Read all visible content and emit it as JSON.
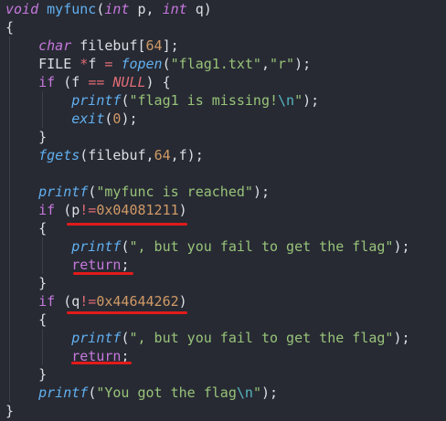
{
  "code": {
    "lines": [
      [
        {
          "t": "void",
          "c": "type"
        },
        {
          "t": " ",
          "c": "plain"
        },
        {
          "t": "myfunc",
          "c": "fn-plain"
        },
        {
          "t": "(",
          "c": "punc"
        },
        {
          "t": "int",
          "c": "type"
        },
        {
          "t": " p, ",
          "c": "plain"
        },
        {
          "t": "int",
          "c": "type"
        },
        {
          "t": " q)",
          "c": "plain"
        }
      ],
      [
        {
          "t": "{",
          "c": "plain"
        }
      ],
      [
        {
          "t": "    ",
          "c": "plain"
        },
        {
          "t": "char",
          "c": "type"
        },
        {
          "t": " filebuf[",
          "c": "plain"
        },
        {
          "t": "64",
          "c": "num"
        },
        {
          "t": "];",
          "c": "plain"
        }
      ],
      [
        {
          "t": "    FILE ",
          "c": "plain"
        },
        {
          "t": "*",
          "c": "op"
        },
        {
          "t": "f ",
          "c": "plain"
        },
        {
          "t": "=",
          "c": "op"
        },
        {
          "t": " ",
          "c": "plain"
        },
        {
          "t": "fopen",
          "c": "fn"
        },
        {
          "t": "(",
          "c": "plain"
        },
        {
          "t": "\"flag1.txt\"",
          "c": "str"
        },
        {
          "t": ",",
          "c": "plain"
        },
        {
          "t": "\"r\"",
          "c": "str"
        },
        {
          "t": ");",
          "c": "plain"
        }
      ],
      [
        {
          "t": "    ",
          "c": "plain"
        },
        {
          "t": "if",
          "c": "kw"
        },
        {
          "t": " (f ",
          "c": "plain"
        },
        {
          "t": "==",
          "c": "op"
        },
        {
          "t": " ",
          "c": "plain"
        },
        {
          "t": "NULL",
          "c": "null"
        },
        {
          "t": ") {",
          "c": "plain"
        }
      ],
      [
        {
          "t": "        ",
          "c": "plain"
        },
        {
          "t": "printf",
          "c": "fn"
        },
        {
          "t": "(",
          "c": "plain"
        },
        {
          "t": "\"flag1 is missing!",
          "c": "str"
        },
        {
          "t": "\\n",
          "c": "esc"
        },
        {
          "t": "\"",
          "c": "str"
        },
        {
          "t": ");",
          "c": "plain"
        }
      ],
      [
        {
          "t": "        ",
          "c": "plain"
        },
        {
          "t": "exit",
          "c": "fn"
        },
        {
          "t": "(",
          "c": "plain"
        },
        {
          "t": "0",
          "c": "num"
        },
        {
          "t": ");",
          "c": "plain"
        }
      ],
      [
        {
          "t": "    }",
          "c": "plain"
        }
      ],
      [
        {
          "t": "    ",
          "c": "plain"
        },
        {
          "t": "fgets",
          "c": "fn"
        },
        {
          "t": "(filebuf,",
          "c": "plain"
        },
        {
          "t": "64",
          "c": "num"
        },
        {
          "t": ",f);",
          "c": "plain"
        }
      ],
      [
        {
          "t": "",
          "c": "plain"
        }
      ],
      [
        {
          "t": "    ",
          "c": "plain"
        },
        {
          "t": "printf",
          "c": "fn"
        },
        {
          "t": "(",
          "c": "plain"
        },
        {
          "t": "\"myfunc is reached\"",
          "c": "str"
        },
        {
          "t": ");",
          "c": "plain"
        }
      ],
      [
        {
          "t": "    ",
          "c": "plain"
        },
        {
          "t": "if",
          "c": "kw"
        },
        {
          "t": " (p",
          "c": "plain"
        },
        {
          "t": "!=",
          "c": "op"
        },
        {
          "t": "0x04081211",
          "c": "num"
        },
        {
          "t": ")",
          "c": "plain"
        }
      ],
      [
        {
          "t": "    {",
          "c": "plain"
        }
      ],
      [
        {
          "t": "        ",
          "c": "plain"
        },
        {
          "t": "printf",
          "c": "fn"
        },
        {
          "t": "(",
          "c": "plain"
        },
        {
          "t": "\", but you fail to get the flag\"",
          "c": "str"
        },
        {
          "t": ");",
          "c": "plain"
        }
      ],
      [
        {
          "t": "        ",
          "c": "plain"
        },
        {
          "t": "return",
          "c": "kw"
        },
        {
          "t": ";",
          "c": "plain"
        }
      ],
      [
        {
          "t": "    }",
          "c": "plain"
        }
      ],
      [
        {
          "t": "    ",
          "c": "plain"
        },
        {
          "t": "if",
          "c": "kw"
        },
        {
          "t": " (q",
          "c": "plain"
        },
        {
          "t": "!=",
          "c": "op"
        },
        {
          "t": "0x44644262",
          "c": "num"
        },
        {
          "t": ")",
          "c": "plain"
        }
      ],
      [
        {
          "t": "    {",
          "c": "plain"
        }
      ],
      [
        {
          "t": "        ",
          "c": "plain"
        },
        {
          "t": "printf",
          "c": "fn"
        },
        {
          "t": "(",
          "c": "plain"
        },
        {
          "t": "\", but you fail to get the flag\"",
          "c": "str"
        },
        {
          "t": ");",
          "c": "plain"
        }
      ],
      [
        {
          "t": "        ",
          "c": "plain"
        },
        {
          "t": "return",
          "c": "kw"
        },
        {
          "t": ";",
          "c": "plain"
        }
      ],
      [
        {
          "t": "    }",
          "c": "plain"
        }
      ],
      [
        {
          "t": "    ",
          "c": "plain"
        },
        {
          "t": "printf",
          "c": "fn"
        },
        {
          "t": "(",
          "c": "plain"
        },
        {
          "t": "\"You got the flag",
          "c": "str"
        },
        {
          "t": "\\n",
          "c": "esc"
        },
        {
          "t": "\"",
          "c": "str"
        },
        {
          "t": ");",
          "c": "plain"
        }
      ],
      [
        {
          "t": "}",
          "c": "plain"
        }
      ]
    ]
  },
  "colors": {
    "background": "#272a33",
    "keyword": "#c678dd",
    "function": "#61afef",
    "number": "#d19a66",
    "string": "#98c379",
    "operator": "#e06c75",
    "annotation_underline": "#e31b1b"
  }
}
